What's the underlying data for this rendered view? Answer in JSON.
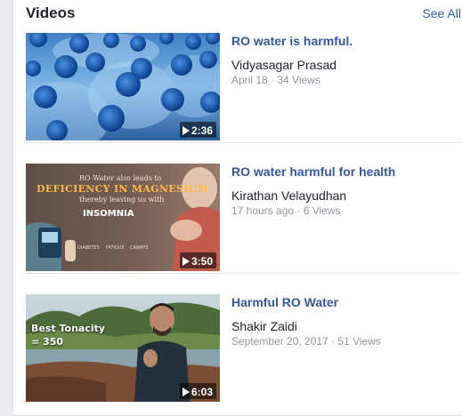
{
  "section": {
    "title": "Videos",
    "see_all": "See All"
  },
  "videos": [
    {
      "title": "RO water is harmful.",
      "author": "Vidyasagar Prasad",
      "meta": "April 18 · 34 Views",
      "duration": "2:36"
    },
    {
      "title": "RO water harmful for health",
      "author": "Kirathan Velayudhan",
      "meta": "17 hours ago · 6 Views",
      "duration": "3:50",
      "thumb_text": {
        "line1": "RO Water also leads to",
        "line2": "DEFICIENCY IN MAGNESIUM",
        "line3": "thereby leaving us with",
        "line4": "INSOMNIA",
        "label_a": "DIABETES",
        "label_b": "FATIGUE",
        "label_c": "CRAMPS"
      }
    },
    {
      "title": "Harmful RO Water",
      "author": "Shakir Zaidi",
      "meta": "September 20, 2017 · 51 Views",
      "duration": "6:03",
      "thumb_text": {
        "line1": "Best Tonacity",
        "line2": "= 350"
      }
    }
  ],
  "colors": {
    "link": "#365899",
    "text": "#1d2129",
    "meta": "#90949c",
    "page_bg": "#e9ebee"
  }
}
